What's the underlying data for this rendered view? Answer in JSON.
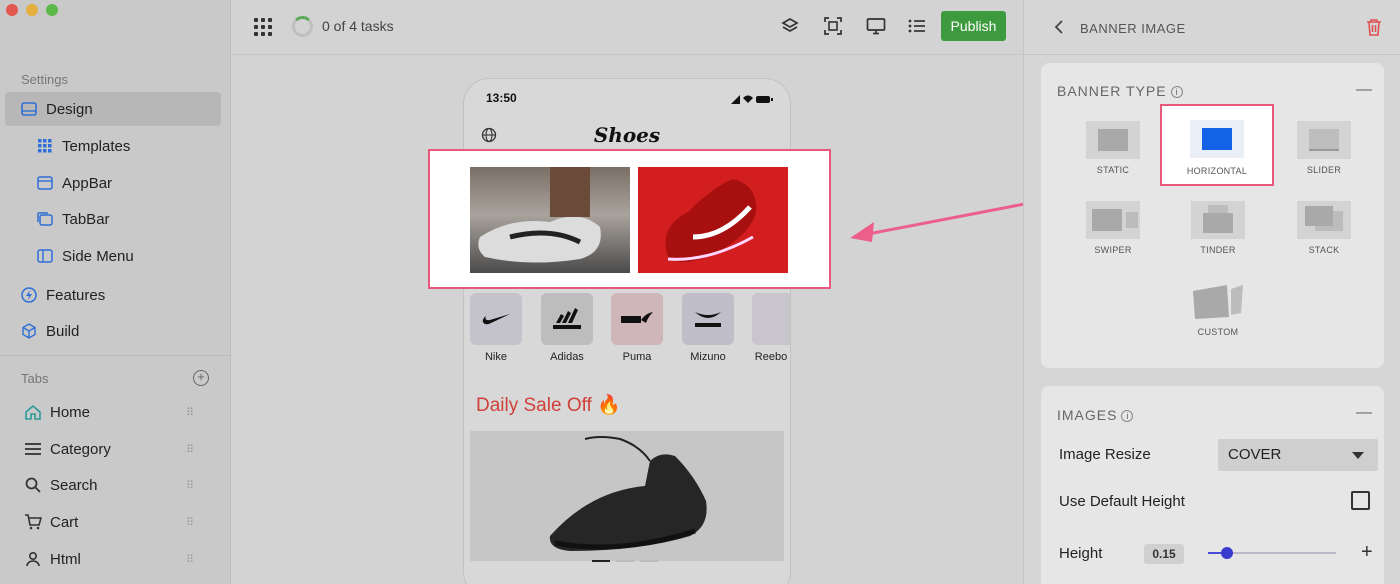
{
  "window": {
    "traffic_colors": [
      "#e4574f",
      "#e3b040",
      "#5cb848"
    ]
  },
  "sidebar": {
    "settings_label": "Settings",
    "items": [
      {
        "label": "Design",
        "icon": "layout-icon"
      },
      {
        "label": "Templates",
        "icon": "grid-icon"
      },
      {
        "label": "AppBar",
        "icon": "appbar-icon"
      },
      {
        "label": "TabBar",
        "icon": "tabbar-icon"
      },
      {
        "label": "Side Menu",
        "icon": "side-menu-icon"
      },
      {
        "label": "Features",
        "icon": "bolt-icon"
      },
      {
        "label": "Build",
        "icon": "cube-icon"
      }
    ],
    "tabs_label": "Tabs",
    "tabs": [
      {
        "label": "Home",
        "icon": "home-icon"
      },
      {
        "label": "Category",
        "icon": "menu-icon"
      },
      {
        "label": "Search",
        "icon": "search-icon"
      },
      {
        "label": "Cart",
        "icon": "cart-icon"
      },
      {
        "label": "Html",
        "icon": "user-icon"
      }
    ]
  },
  "toolbar": {
    "tasks": "0 of 4 tasks",
    "tasks_done": 0,
    "tasks_total": 4,
    "publish_label": "Publish",
    "accent": "#3e9a3e"
  },
  "phone": {
    "time": "13:50",
    "app_title": "Shoes",
    "brands": [
      "Nike",
      "Adidas",
      "Puma",
      "Mizuno",
      "Reebo"
    ],
    "sale_title": "Daily Sale Off 🔥"
  },
  "panel": {
    "title": "BANNER IMAGE",
    "banner_type_title": "BANNER TYPE",
    "banner_types": [
      "STATIC",
      "HORIZONTAL",
      "SLIDER",
      "SWIPER",
      "TINDER",
      "STACK",
      "CUSTOM"
    ],
    "selected_type": "HORIZONTAL",
    "images_title": "IMAGES",
    "image_resize_label": "Image Resize",
    "image_resize_value": "COVER",
    "default_height_label": "Use Default Height",
    "height_label": "Height",
    "height_value": "0.15",
    "height_fraction": 0.15
  }
}
